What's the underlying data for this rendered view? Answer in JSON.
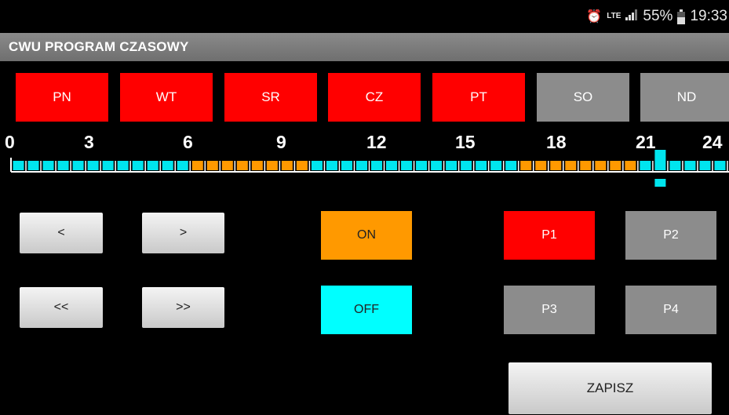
{
  "status": {
    "battery": "55%",
    "time": "19:33",
    "network": "LTE"
  },
  "title": "CWU PROGRAM CZASOWY",
  "days": [
    {
      "label": "PN",
      "active": true
    },
    {
      "label": "WT",
      "active": true
    },
    {
      "label": "SR",
      "active": true
    },
    {
      "label": "CZ",
      "active": true
    },
    {
      "label": "PT",
      "active": true
    },
    {
      "label": "SO",
      "active": false
    },
    {
      "label": "ND",
      "active": false
    }
  ],
  "hour_labels": [
    "0",
    "3",
    "6",
    "9",
    "12",
    "15",
    "18",
    "21",
    "24"
  ],
  "schedule": {
    "slot_count": 48,
    "on_slots": [
      12,
      13,
      14,
      15,
      16,
      17,
      18,
      19,
      34,
      35,
      36,
      37,
      38,
      39,
      40,
      41
    ],
    "cursor_slot": 43,
    "colors": {
      "on": "#ff9900",
      "off": "#00e5ee",
      "cursor": "#00e5ee"
    }
  },
  "controls": {
    "prev": "<",
    "next": ">",
    "prev_fast": "<<",
    "next_fast": ">>",
    "on": "ON",
    "off": "OFF"
  },
  "programs": [
    {
      "label": "P1",
      "active": true
    },
    {
      "label": "P2",
      "active": false
    },
    {
      "label": "P3",
      "active": false
    },
    {
      "label": "P4",
      "active": false
    }
  ],
  "save_label": "ZAPISZ",
  "colors": {
    "active_red": "#ff0000",
    "inactive_gray": "#8c8c8c",
    "on_orange": "#ff9900",
    "off_cyan": "#00ffff"
  }
}
